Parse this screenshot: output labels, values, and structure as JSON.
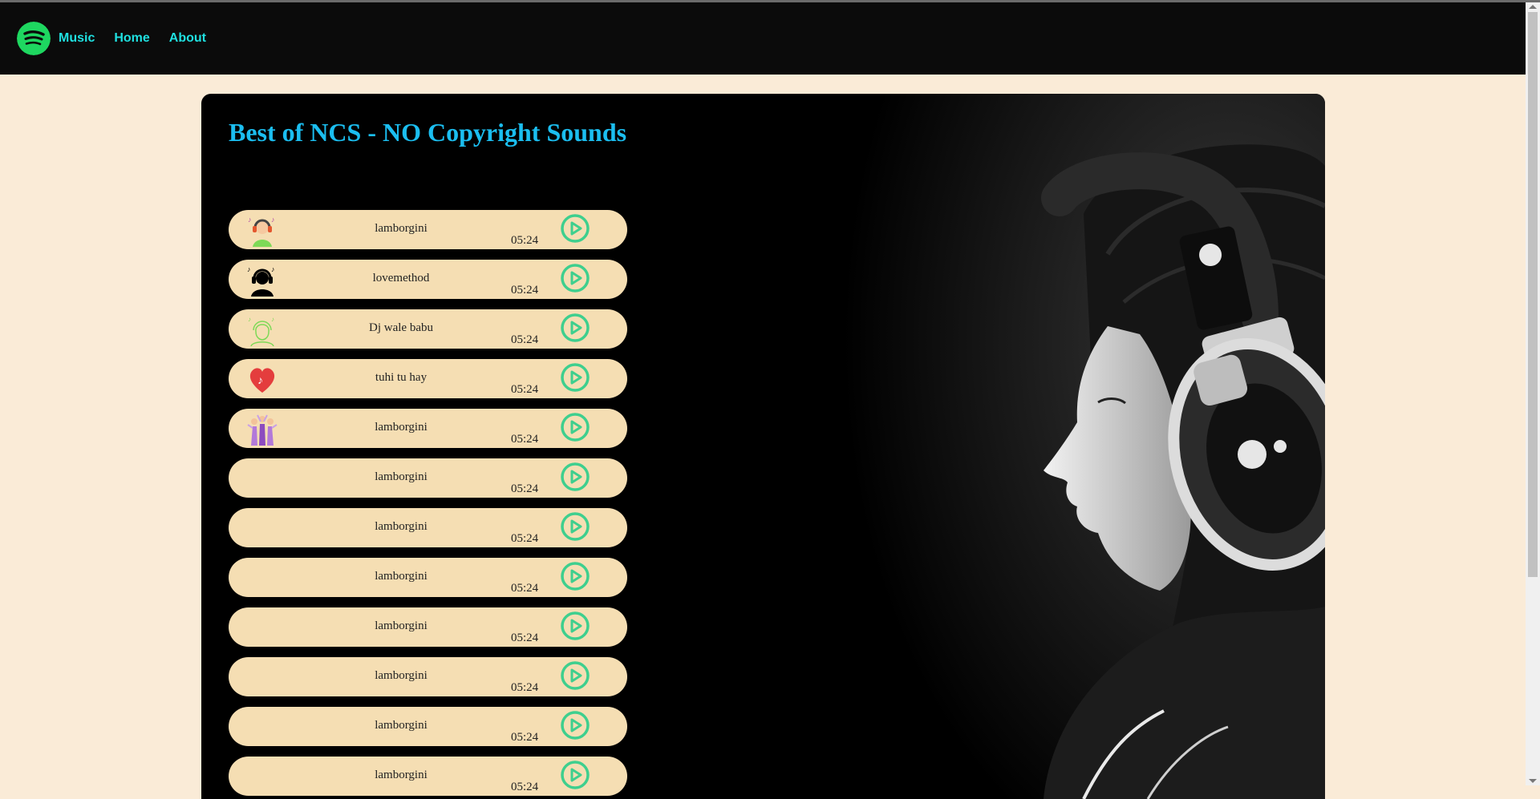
{
  "nav": {
    "brand": "Music",
    "links": [
      "Home",
      "About"
    ],
    "logo_icon": "spotify-logo-icon"
  },
  "main": {
    "title": "Best of NCS - NO Copyright Sounds"
  },
  "songs": [
    {
      "name": "lamborgini",
      "duration": "05:24",
      "icon": "person-with-headphones-icon"
    },
    {
      "name": "lovemethod",
      "duration": "05:24",
      "icon": "headphones-silhouette-icon"
    },
    {
      "name": "Dj wale babu",
      "duration": "05:24",
      "icon": "line-headphones-icon"
    },
    {
      "name": "tuhi tu hay",
      "duration": "05:24",
      "icon": "music-heart-icon"
    },
    {
      "name": "lamborgini",
      "duration": "05:24",
      "icon": "dancing-people-icon"
    },
    {
      "name": "lamborgini",
      "duration": "05:24",
      "icon": ""
    },
    {
      "name": "lamborgini",
      "duration": "05:24",
      "icon": ""
    },
    {
      "name": "lamborgini",
      "duration": "05:24",
      "icon": ""
    },
    {
      "name": "lamborgini",
      "duration": "05:24",
      "icon": ""
    },
    {
      "name": "lamborgini",
      "duration": "05:24",
      "icon": ""
    },
    {
      "name": "lamborgini",
      "duration": "05:24",
      "icon": ""
    },
    {
      "name": "lamborgini",
      "duration": "05:24",
      "icon": ""
    }
  ],
  "colors": {
    "page_bg": "#FAEBD7",
    "navbar_bg": "#0b0b0b",
    "nav_link": "#1fe0e0",
    "title": "#1bbef0",
    "song_bg": "#F5DEB3",
    "play_ring": "#3ecf8e",
    "spotify_green": "#1ed760"
  }
}
